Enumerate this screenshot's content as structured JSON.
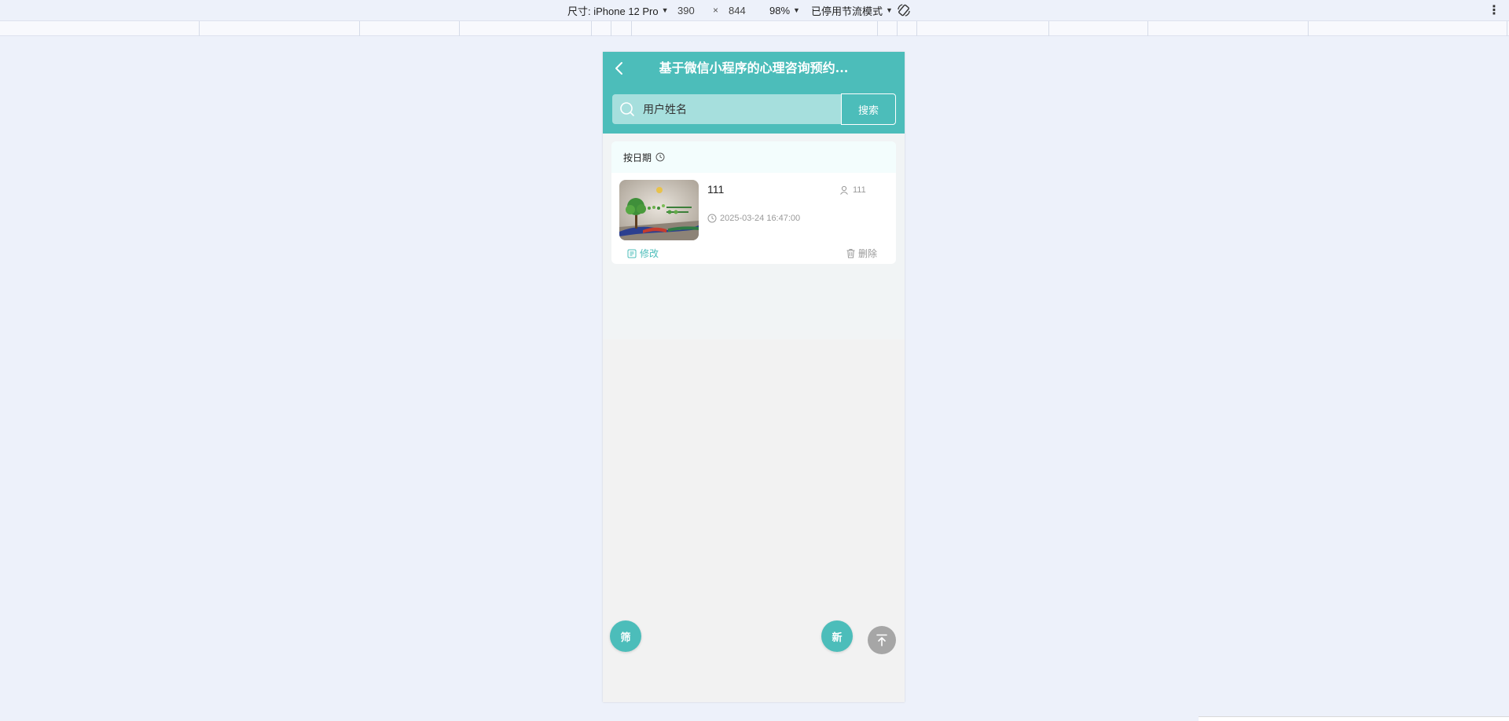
{
  "devtools": {
    "size_label": "尺寸: iPhone 12 Pro",
    "width": "390",
    "times": "×",
    "height": "844",
    "zoom": "98%",
    "throttle": "已停用节流模式",
    "icons": {
      "caret": "caret-down-icon",
      "rotate": "rotate-icon",
      "more": "more-vertical-icon"
    }
  },
  "app": {
    "title": "基于微信小程序的心理咨询预约...",
    "accent_color": "#4cbdba",
    "search": {
      "placeholder": "用户姓名",
      "button_label": "搜索"
    },
    "sort_label": "按日期",
    "items": [
      {
        "title": "111",
        "user": "111",
        "time": "2025-03-24 16:47:00",
        "edit_label": "修改",
        "delete_label": "删除"
      }
    ],
    "fab": {
      "filter_label": "筛",
      "new_label": "新"
    }
  }
}
